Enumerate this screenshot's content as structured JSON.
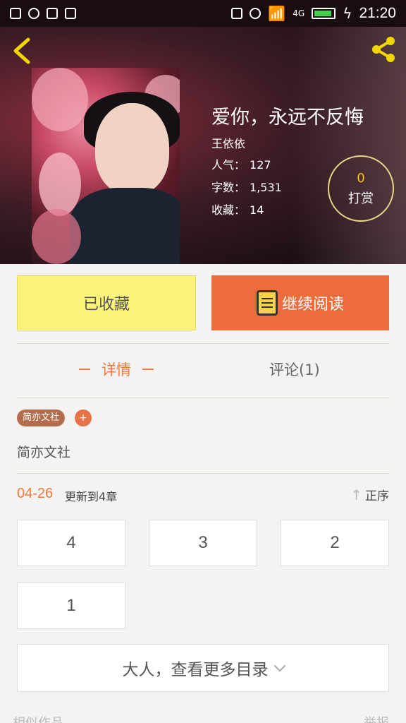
{
  "status_bar": {
    "network": "4G",
    "time": "21:20"
  },
  "book": {
    "title": "爱你，永远不反悔",
    "author": "王依依",
    "stats": [
      {
        "label": "人气：",
        "value": "127"
      },
      {
        "label": "字数：",
        "value": "1,531"
      },
      {
        "label": "收藏：",
        "value": "14"
      }
    ],
    "tip_count": "0",
    "tip_label": "打赏"
  },
  "actions": {
    "collected_label": "已收藏",
    "read_label": "继续阅读"
  },
  "tabs": {
    "detail_label": "详情",
    "comments_label": "评论(1)"
  },
  "publisher": {
    "tag": "简亦文社",
    "add": "+",
    "description": "简亦文社"
  },
  "update": {
    "date": "04-26",
    "text": "更新到4章",
    "sort_label": "正序"
  },
  "chapters": [
    "4",
    "3",
    "2",
    "1"
  ],
  "more_catalog_label": "大人，查看更多目录",
  "bottom": {
    "left_text": "相似作品",
    "right_text": "举报"
  },
  "colors": {
    "accent": "#ec6c3d",
    "collected_bg": "#fbf27c",
    "tab_active": "#ec7a42",
    "back_icon": "#f2d600"
  }
}
